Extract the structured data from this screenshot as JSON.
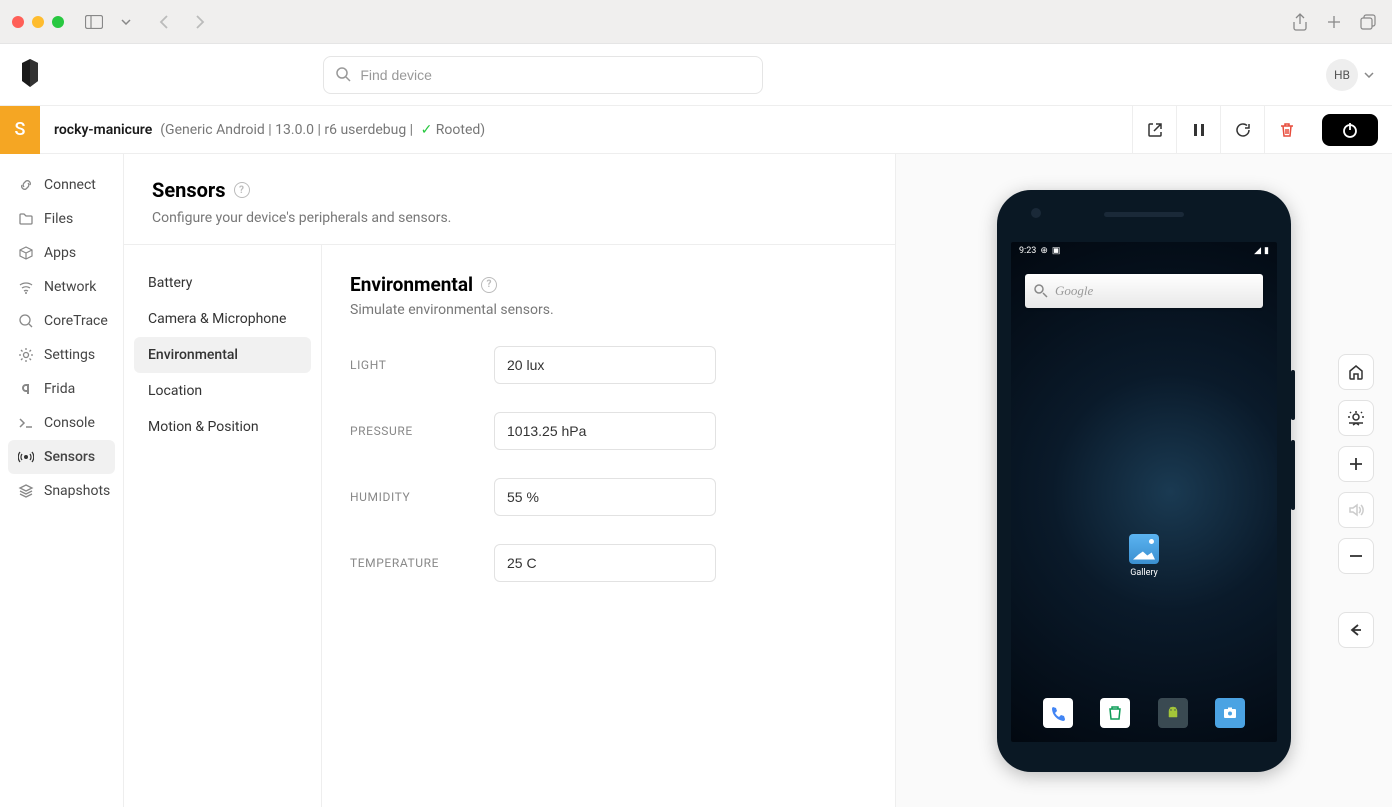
{
  "titlebar": {
    "actions": []
  },
  "topbar": {
    "search_placeholder": "Find device",
    "user_initials": "HB"
  },
  "device_bar": {
    "badge_letter": "S",
    "name": "rocky-manicure",
    "os": "Generic Android",
    "version": "13.0.0",
    "build": "r6 userdebug",
    "rooted_label": "Rooted"
  },
  "sidebar": {
    "items": [
      {
        "label": "Connect",
        "icon": "link"
      },
      {
        "label": "Files",
        "icon": "folder"
      },
      {
        "label": "Apps",
        "icon": "grid"
      },
      {
        "label": "Network",
        "icon": "wifi"
      },
      {
        "label": "CoreTrace",
        "icon": "search"
      },
      {
        "label": "Settings",
        "icon": "gear"
      },
      {
        "label": "Frida",
        "icon": "frida"
      },
      {
        "label": "Console",
        "icon": "terminal"
      },
      {
        "label": "Sensors",
        "icon": "sensors",
        "active": true
      },
      {
        "label": "Snapshots",
        "icon": "layers"
      }
    ]
  },
  "content": {
    "title": "Sensors",
    "subtitle": "Configure your device's peripherals and sensors."
  },
  "subnav": {
    "items": [
      {
        "label": "Battery"
      },
      {
        "label": "Camera & Microphone"
      },
      {
        "label": "Environmental",
        "active": true
      },
      {
        "label": "Location"
      },
      {
        "label": "Motion & Position"
      }
    ]
  },
  "panel": {
    "title": "Environmental",
    "subtitle": "Simulate environmental sensors.",
    "fields": [
      {
        "label": "LIGHT",
        "value": "20 lux"
      },
      {
        "label": "PRESSURE",
        "value": "1013.25 hPa"
      },
      {
        "label": "HUMIDITY",
        "value": "55 %"
      },
      {
        "label": "TEMPERATURE",
        "value": "25 C"
      }
    ]
  },
  "phone": {
    "time": "9:23",
    "search_text": "Google",
    "gallery_label": "Gallery"
  }
}
